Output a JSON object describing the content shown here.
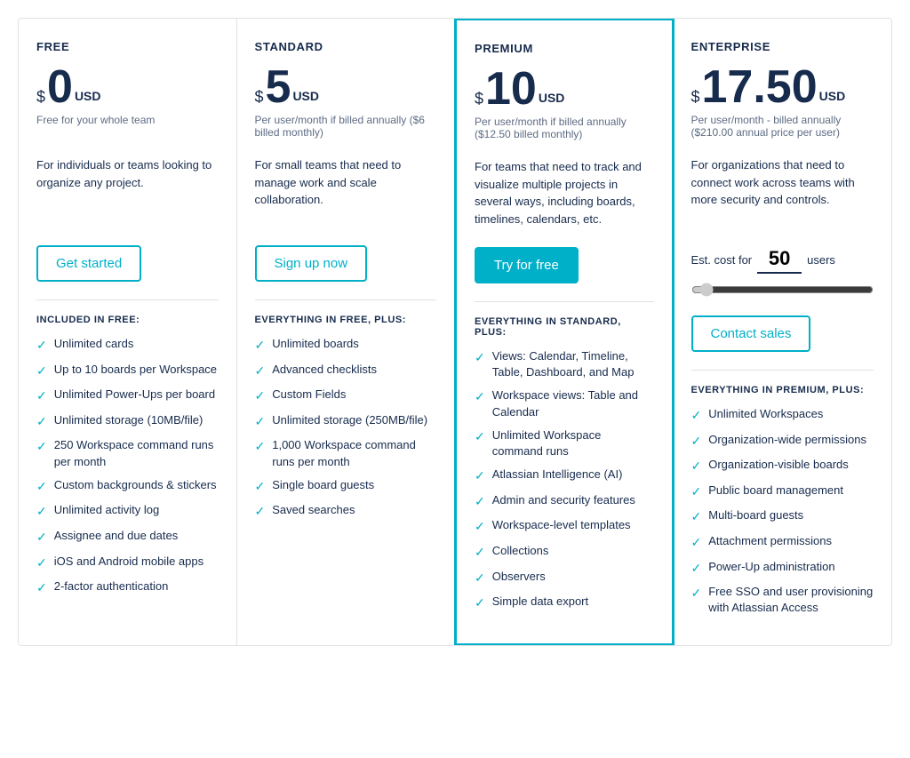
{
  "plans": [
    {
      "id": "free",
      "name": "FREE",
      "price_symbol": "$",
      "price_amount": "0",
      "price_usd": "USD",
      "price_note": "Free for your whole team",
      "description": "For individuals or teams looking to organize any project.",
      "cta_label": "Get started",
      "cta_style": "outline",
      "highlighted": false,
      "section_title": "INCLUDED IN FREE:",
      "features": [
        "Unlimited cards",
        "Up to 10 boards per Workspace",
        "Unlimited Power-Ups per board",
        "Unlimited storage (10MB/file)",
        "250 Workspace command runs per month",
        "Custom backgrounds & stickers",
        "Unlimited activity log",
        "Assignee and due dates",
        "iOS and Android mobile apps",
        "2-factor authentication"
      ]
    },
    {
      "id": "standard",
      "name": "STANDARD",
      "price_symbol": "$",
      "price_amount": "5",
      "price_usd": "USD",
      "price_note": "Per user/month if billed annually ($6 billed monthly)",
      "description": "For small teams that need to manage work and scale collaboration.",
      "cta_label": "Sign up now",
      "cta_style": "outline",
      "highlighted": false,
      "section_title": "EVERYTHING IN FREE, PLUS:",
      "features": [
        "Unlimited boards",
        "Advanced checklists",
        "Custom Fields",
        "Unlimited storage (250MB/file)",
        "1,000 Workspace command runs per month",
        "Single board guests",
        "Saved searches"
      ]
    },
    {
      "id": "premium",
      "name": "PREMIUM",
      "price_symbol": "$",
      "price_amount": "10",
      "price_usd": "USD",
      "price_note": "Per user/month if billed annually ($12.50 billed monthly)",
      "description": "For teams that need to track and visualize multiple projects in several ways, including boards, timelines, calendars, etc.",
      "cta_label": "Try for free",
      "cta_style": "filled",
      "highlighted": true,
      "section_title": "EVERYTHING IN STANDARD, PLUS:",
      "features": [
        "Views: Calendar, Timeline, Table, Dashboard, and Map",
        "Workspace views: Table and Calendar",
        "Unlimited Workspace command runs",
        "Atlassian Intelligence (AI)",
        "Admin and security features",
        "Workspace-level templates",
        "Collections",
        "Observers",
        "Simple data export"
      ]
    },
    {
      "id": "enterprise",
      "name": "ENTERPRISE",
      "price_symbol": "$",
      "price_amount": "17.50",
      "price_usd": "USD",
      "price_note": "Per user/month - billed annually ($210.00 annual price per user)",
      "description": "For organizations that need to connect work across teams with more security and controls.",
      "cta_label": "Contact sales",
      "cta_style": "outline",
      "highlighted": false,
      "has_slider": true,
      "slider_label_before": "Est. cost for",
      "slider_label_after": "users",
      "slider_value": "50",
      "section_title": "EVERYTHING IN PREMIUM, PLUS:",
      "features": [
        "Unlimited Workspaces",
        "Organization-wide permissions",
        "Organization-visible boards",
        "Public board management",
        "Multi-board guests",
        "Attachment permissions",
        "Power-Up administration",
        "Free SSO and user provisioning with Atlassian Access"
      ]
    }
  ],
  "icons": {
    "check": "✓"
  }
}
